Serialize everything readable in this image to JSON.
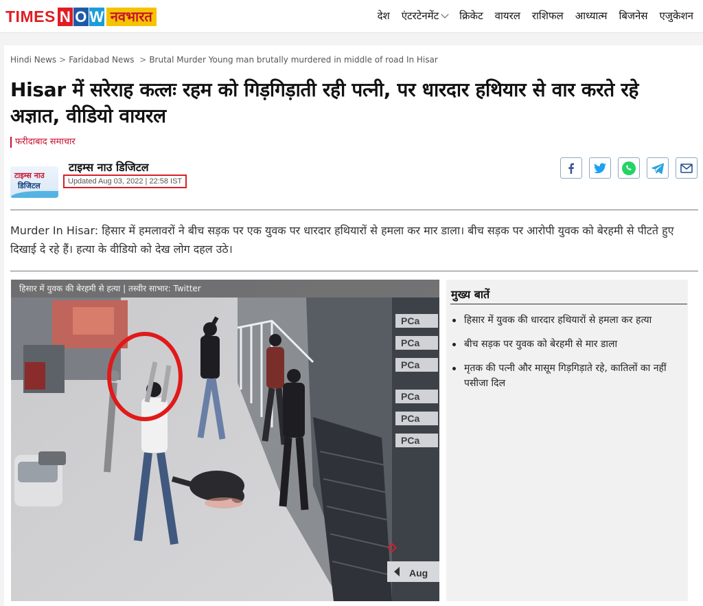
{
  "header": {
    "logo": {
      "times": "TIMES",
      "now": [
        "N",
        "O",
        "W"
      ],
      "navbharat": "नवभारत"
    },
    "nav": [
      "देश",
      "एंटरटेनमेंट",
      "क्रिकेट",
      "वायरल",
      "राशिफल",
      "आध्यात्म",
      "बिजनेस",
      "एजुकेशन"
    ]
  },
  "breadcrumb": [
    "Hindi News",
    "Faridabad News",
    "Brutal Murder Young man brutally murdered in middle of road In Hisar"
  ],
  "article": {
    "headline": "Hisar में सरेराह कत्लः रहम को गिड़गिड़ाती रही पत्नी, पर धारदार हथियार से वार करते रहे अज्ञात, वीडियो वायरल",
    "category": "फरीदाबाद समाचार",
    "author_logo": {
      "line1": "टाइम्स नाउ",
      "line2": "डिजिटल"
    },
    "author": "टाइम्स नाउ डिजिटल",
    "updated": "Updated Aug 03, 2022 | 22:58 IST",
    "intro": "Murder In Hisar: हिसार में हमलावरों ने बीच सड़क पर एक युवक पर धारदार हथियारों से हमला कर मार डाला। बीच सड़क पर आरोपी युवक को बेरहमी से पीटते हुए दिखाई दे रहे हैं। हत्या के वीडियो को देख लोग दहल उठे।",
    "image_caption": "हिसार में युवक की बेरहमी से हत्या  |  तस्वीर साभार: Twitter",
    "sign_texts": [
      "PCa",
      "PCa",
      "PCa",
      "PCa",
      "PCa",
      "PCa"
    ],
    "timestamp_text": "Aug"
  },
  "share_icons": [
    "facebook-icon",
    "twitter-icon",
    "whatsapp-icon",
    "telegram-icon",
    "mail-icon"
  ],
  "share_colors": {
    "facebook": "#3b5998",
    "twitter": "#1da1f2",
    "whatsapp": "#25d366",
    "telegram": "#2aa3df",
    "mail": "#1f4e8c"
  },
  "highlights": {
    "title": "मुख्य बातें",
    "items": [
      "हिसार में युवक की धारदार हथियारों से हमला कर हत्या",
      "बीच सड़क पर युवक को बेरहमी से मार डाला",
      "मृतक की पत्नी और मासूम गिड़गिड़ाते रहे, कातिलों का नहीं पसीजा दिल"
    ]
  },
  "colors": {
    "brand_red": "#e11d23",
    "highlight_box": "#d81f26",
    "category_red": "#c8102e"
  }
}
